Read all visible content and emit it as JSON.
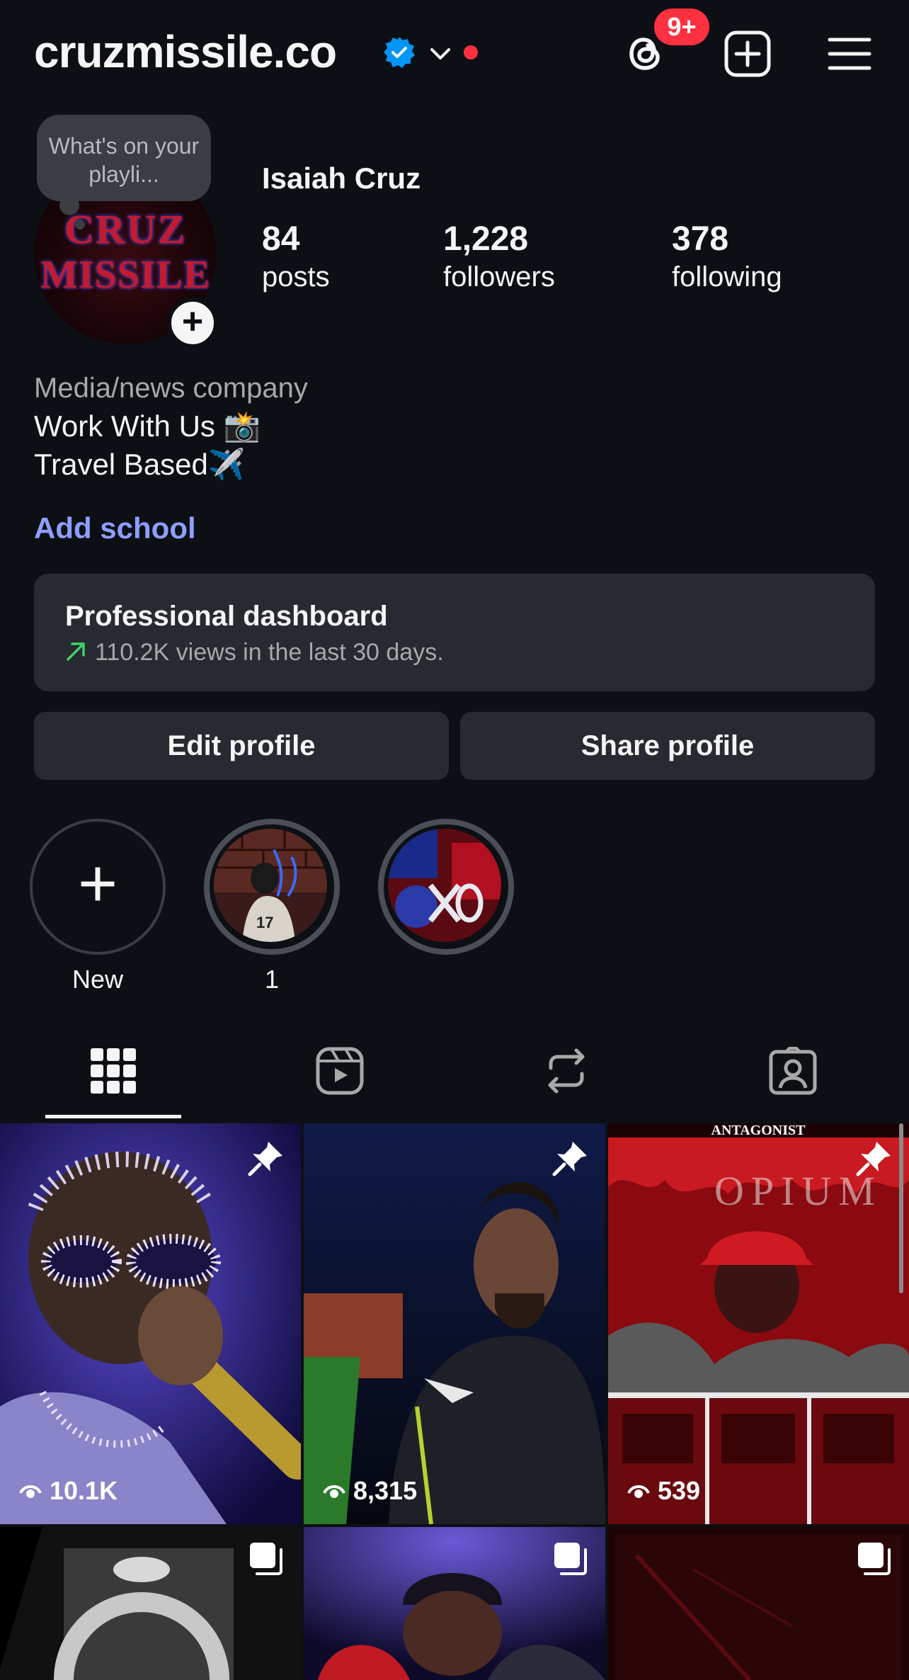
{
  "header": {
    "username": "cruzmissile.co",
    "notification_badge": "9+",
    "accent_color": "#0095f6",
    "badge_color": "#ff3040",
    "icons": [
      "verified-badge-icon",
      "chevron-down-icon",
      "threads-icon",
      "new-post-icon",
      "menu-icon"
    ]
  },
  "profile": {
    "note": "What's on your playli...",
    "avatar_text_line1": "CRUZ",
    "avatar_text_line2": "MISSILE",
    "full_name": "Isaiah Cruz",
    "stats": [
      {
        "value": "84",
        "label": "posts"
      },
      {
        "value": "1,228",
        "label": "followers"
      },
      {
        "value": "378",
        "label": "following"
      }
    ],
    "category": "Media/news company",
    "bio": [
      "Work With Us 📸",
      "Travel Based✈️"
    ],
    "add_school": "Add school"
  },
  "dashboard": {
    "title": "Professional dashboard",
    "subtitle": "110.2K views in the last 30 days.",
    "trend_color": "#3fd16b"
  },
  "buttons": {
    "edit": "Edit profile",
    "share": "Share profile"
  },
  "highlights": [
    {
      "label": "New"
    },
    {
      "label": "1"
    },
    {
      "label": ""
    }
  ],
  "tabs": [
    "grid-tab",
    "reels-tab",
    "reposts-tab",
    "tagged-tab"
  ],
  "posts": [
    {
      "views": "10.1K",
      "pinned": true
    },
    {
      "views": "8,315",
      "pinned": true
    },
    {
      "views": "539",
      "pinned": true,
      "overlay_text": "ANTAGONIST",
      "overlay_text2": "OPIUM"
    },
    {
      "views": "",
      "carousel": true
    },
    {
      "views": "",
      "carousel": true
    },
    {
      "views": "",
      "carousel": true
    }
  ]
}
